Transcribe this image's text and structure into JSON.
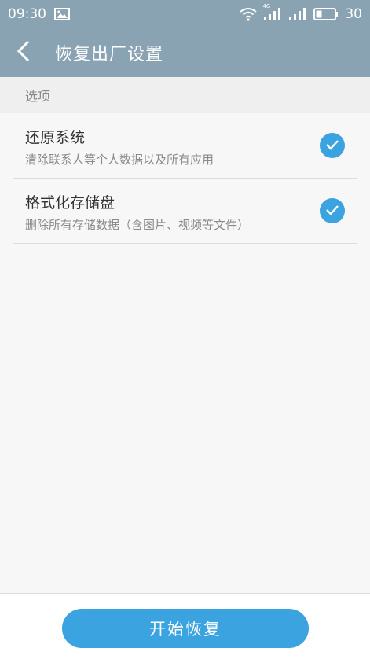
{
  "status_bar": {
    "time": "09:30",
    "battery": "30",
    "network_label": "4G",
    "icons": [
      "image-icon",
      "wifi-icon",
      "signal-4g-icon",
      "signal-icon",
      "battery-icon"
    ]
  },
  "header": {
    "title": "恢复出厂设置",
    "back_icon": "chevron-left-icon"
  },
  "section": {
    "label": "选项"
  },
  "options": [
    {
      "title": "还原系统",
      "subtitle": "清除联系人等个人数据以及所有应用",
      "checked": true
    },
    {
      "title": "格式化存储盘",
      "subtitle": "删除所有存储数据（含图片、视频等文件）",
      "checked": true
    }
  ],
  "footer": {
    "button_label": "开始恢复"
  },
  "colors": {
    "header_bg": "#8aa3b3",
    "accent": "#3aa3e0",
    "page_bg": "#f7f7f7"
  }
}
